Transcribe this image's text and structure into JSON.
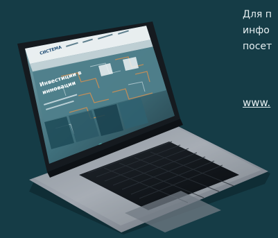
{
  "promo": {
    "lines": [
      "Для п",
      "инфо",
      "посет"
    ],
    "link": "www."
  },
  "website": {
    "brand": "СИСТЕМА",
    "hero_title_line1": "Инвестиции в",
    "hero_title_line2": "инновации"
  }
}
